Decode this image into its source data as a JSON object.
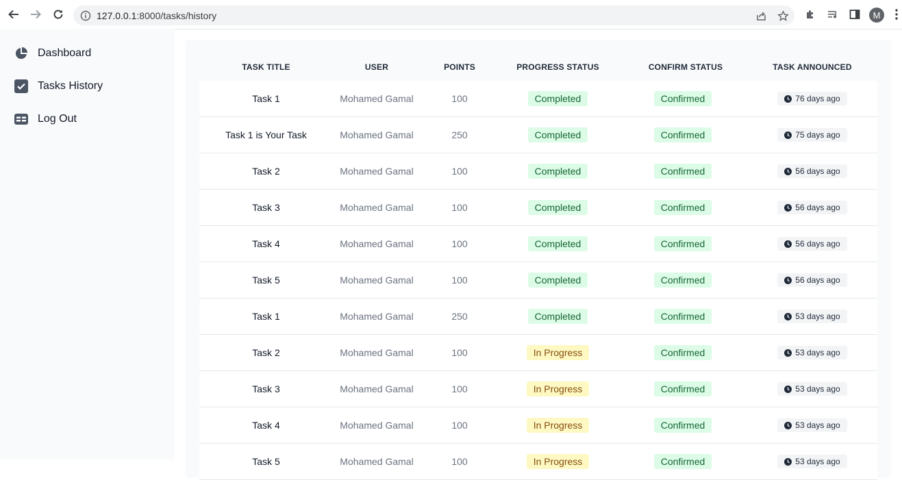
{
  "browser": {
    "url_host": "127.0.0.1",
    "url_rest": ":8000/tasks/history",
    "avatar_initial": "M",
    "icons": [
      "back-arrow-icon",
      "forward-arrow-icon",
      "reload-icon",
      "info-icon",
      "share-icon",
      "star-icon",
      "puzzle-icon",
      "media-icon",
      "sidepanel-icon",
      "more-vertical-icon"
    ]
  },
  "sidebar": {
    "items": [
      {
        "label": "Dashboard",
        "icon": "pie-chart-icon"
      },
      {
        "label": "Tasks History",
        "icon": "checkbox-icon"
      },
      {
        "label": "Log Out",
        "icon": "table-icon"
      }
    ]
  },
  "table": {
    "headers": [
      "TASK TITLE",
      "USER",
      "POINTS",
      "PROGRESS STATUS",
      "CONFIRM STATUS",
      "TASK ANNOUNCED"
    ],
    "rows": [
      {
        "title": "Task 1",
        "user": "Mohamed Gamal",
        "points": "100",
        "progress": "Completed",
        "confirm": "Confirmed",
        "announced": "76 days ago"
      },
      {
        "title": "Task 1 is Your Task",
        "user": "Mohamed Gamal",
        "points": "250",
        "progress": "Completed",
        "confirm": "Confirmed",
        "announced": "75 days ago"
      },
      {
        "title": "Task 2",
        "user": "Mohamed Gamal",
        "points": "100",
        "progress": "Completed",
        "confirm": "Confirmed",
        "announced": "56 days ago"
      },
      {
        "title": "Task 3",
        "user": "Mohamed Gamal",
        "points": "100",
        "progress": "Completed",
        "confirm": "Confirmed",
        "announced": "56 days ago"
      },
      {
        "title": "Task 4",
        "user": "Mohamed Gamal",
        "points": "100",
        "progress": "Completed",
        "confirm": "Confirmed",
        "announced": "56 days ago"
      },
      {
        "title": "Task 5",
        "user": "Mohamed Gamal",
        "points": "100",
        "progress": "Completed",
        "confirm": "Confirmed",
        "announced": "56 days ago"
      },
      {
        "title": "Task 1",
        "user": "Mohamed Gamal",
        "points": "250",
        "progress": "Completed",
        "confirm": "Confirmed",
        "announced": "53 days ago"
      },
      {
        "title": "Task 2",
        "user": "Mohamed Gamal",
        "points": "100",
        "progress": "In Progress",
        "confirm": "Confirmed",
        "announced": "53 days ago"
      },
      {
        "title": "Task 3",
        "user": "Mohamed Gamal",
        "points": "100",
        "progress": "In Progress",
        "confirm": "Confirmed",
        "announced": "53 days ago"
      },
      {
        "title": "Task 4",
        "user": "Mohamed Gamal",
        "points": "100",
        "progress": "In Progress",
        "confirm": "Confirmed",
        "announced": "53 days ago"
      },
      {
        "title": "Task 5",
        "user": "Mohamed Gamal",
        "points": "100",
        "progress": "In Progress",
        "confirm": "Confirmed",
        "announced": "53 days ago"
      }
    ]
  },
  "colors": {
    "completed_bg": "#dcfce7",
    "completed_fg": "#166534",
    "in_progress_bg": "#fef9c3",
    "in_progress_fg": "#854d0e",
    "sidebar_icon": "#4b5563",
    "tab_accent": "#f3c46a"
  }
}
